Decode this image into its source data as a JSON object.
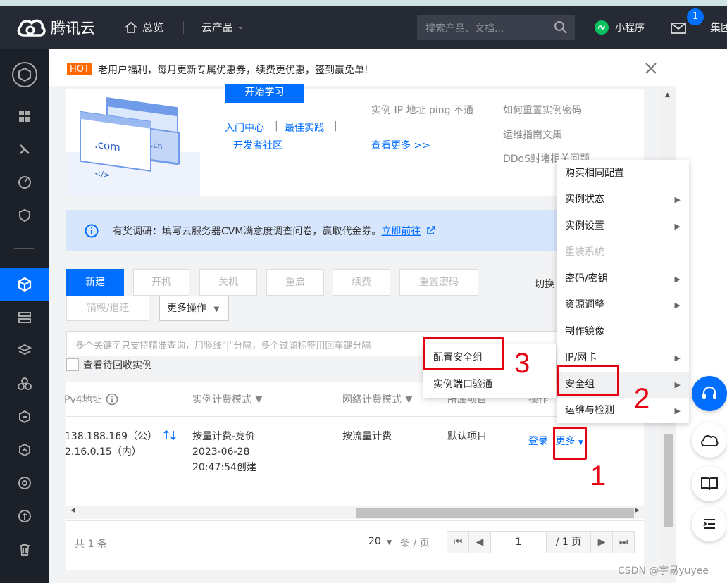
{
  "header": {
    "logo_text": "腾讯云",
    "nav_overview": "总览",
    "nav_products": "云产品",
    "search_placeholder": "搜索产品、文档...",
    "mini_program": "小程序",
    "mail_badge": "1",
    "group": "集团"
  },
  "banner": {
    "hot_tag": "HOT",
    "hot_text": "老用户福利，每月更新专属优惠券，续费更优惠，签到赢免单!"
  },
  "learn_card": {
    "start_button": "开始学习",
    "links": [
      "入门中心",
      "最佳实践",
      "开发者社区"
    ],
    "separator": "|",
    "faq_1": "实例 IP 地址 ping 不通",
    "see_more": "查看更多 >>",
    "faq_2": "如何重置实例密码",
    "faq_3": "运维指南文集",
    "faq_4": "DDoS封堵相关问题",
    "illus_com": ".com",
    "illus_cn": ".cn",
    "illus_code": "</>"
  },
  "notice": {
    "text": "有奖调研：填写云服务器CVM满意度调查问卷，赢取代金券。",
    "link": "立即前往"
  },
  "toolbar": {
    "new": "新建",
    "start": "开机",
    "stop": "关机",
    "restart": "重启",
    "renew": "续费",
    "reset_pwd": "重置密码",
    "destroy": "销毁/退还",
    "more_ops": "更多操作",
    "switch": "切换"
  },
  "filter": {
    "placeholder": "多个关键字只支持精准查询，用竖线\"|\"分隔，多个过滤标签用回车键分隔",
    "recycle_label": "查看待回收实例"
  },
  "table": {
    "headers": [
      "Pv4地址",
      "实例计费模式",
      "网络计费模式",
      "所属项目",
      "操作"
    ],
    "row": {
      "ip_public": "138.188.169（公）",
      "ip_private": "2.16.0.15（内）",
      "billing_1": "按量计费-竞价",
      "billing_2": "2023-06-28",
      "billing_3": "20:47:54创建",
      "network": "按流量计费",
      "project": "默认项目",
      "op_login": "登录",
      "op_more": "更多"
    }
  },
  "pagination": {
    "total": "共 1 条",
    "page_size": "20",
    "per_page": "条 / 页",
    "current": "1",
    "total_pages": "/ 1 页"
  },
  "menu": {
    "items": [
      {
        "label": "购买相同配置",
        "arrow": false,
        "disabled": false
      },
      {
        "label": "实例状态",
        "arrow": true,
        "disabled": false
      },
      {
        "label": "实例设置",
        "arrow": true,
        "disabled": false
      },
      {
        "label": "重装系统",
        "arrow": false,
        "disabled": true
      },
      {
        "label": "密码/密钥",
        "arrow": true,
        "disabled": false
      },
      {
        "label": "资源调整",
        "arrow": true,
        "disabled": false
      },
      {
        "label": "制作镜像",
        "arrow": false,
        "disabled": false
      },
      {
        "label": "IP/网卡",
        "arrow": true,
        "disabled": false
      },
      {
        "label": "安全组",
        "arrow": true,
        "disabled": false
      },
      {
        "label": "运维与检测",
        "arrow": true,
        "disabled": false
      }
    ]
  },
  "submenu": {
    "items": [
      "配置安全组",
      "实例端口验通"
    ]
  },
  "annotations": {
    "n1": "1",
    "n2": "2",
    "n3": "3"
  },
  "watermark": "CSDN @宇易yuyee",
  "colors": {
    "topbar": "#252a34",
    "sidebar": "#1c2028",
    "primary": "#006eff",
    "hot": "#ff6a00",
    "annotation_red": "#e60012"
  }
}
